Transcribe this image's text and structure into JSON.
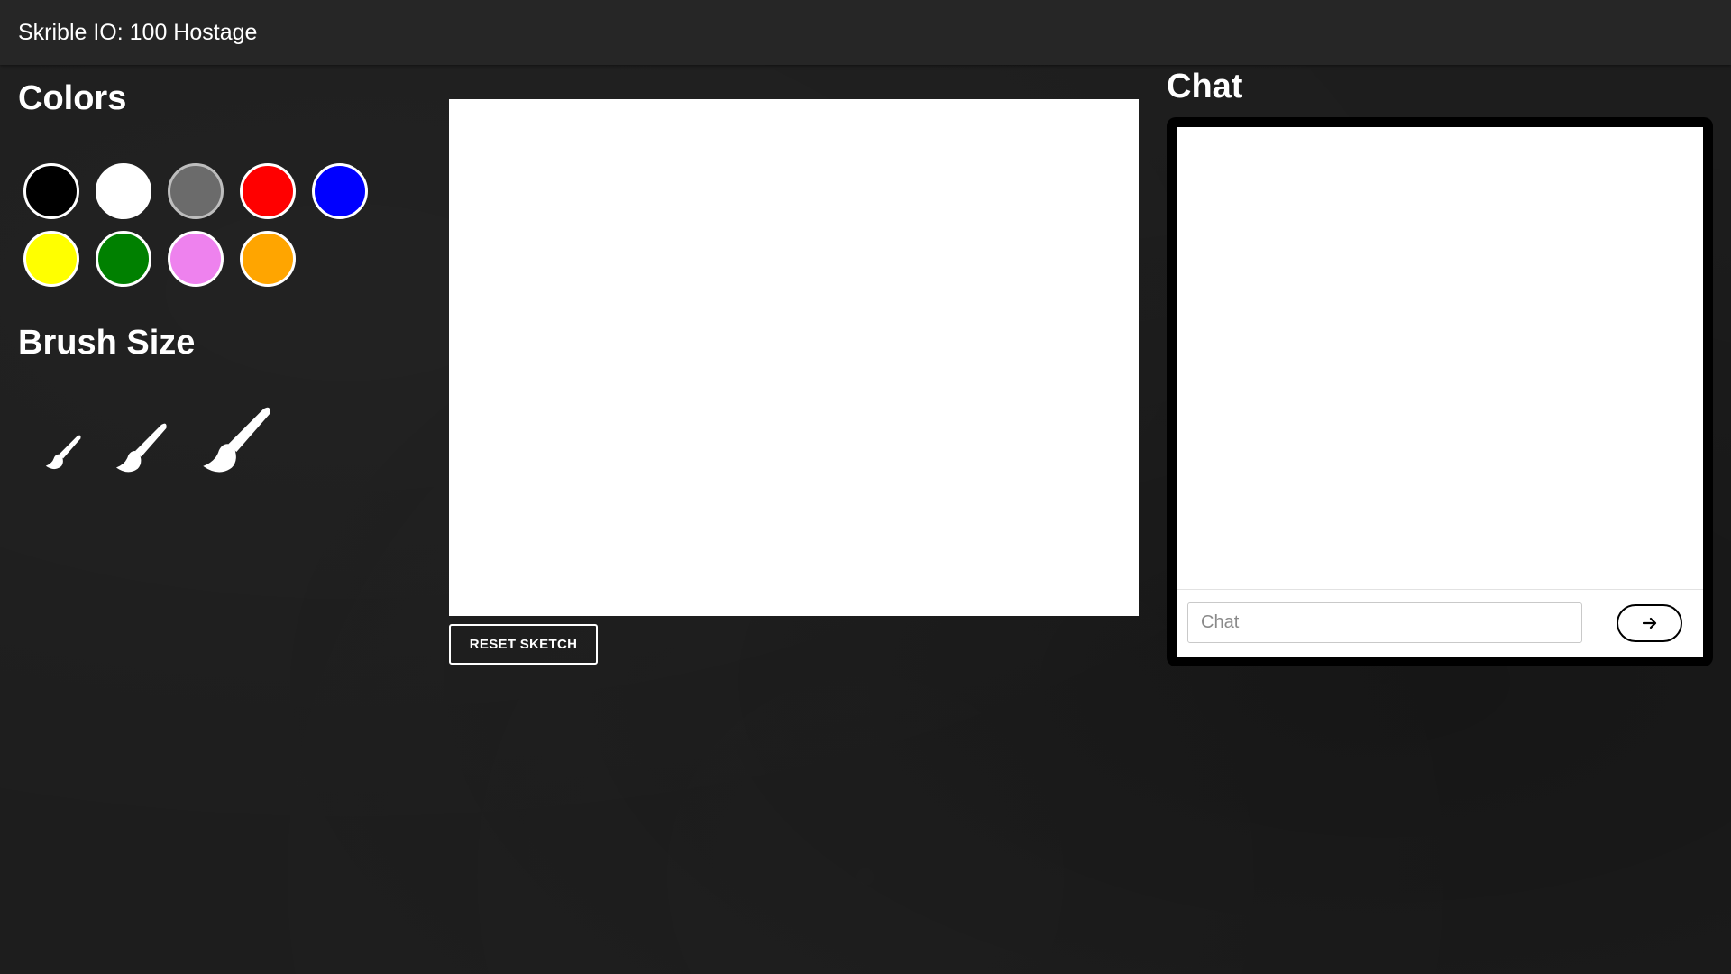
{
  "header": {
    "title": "Skrible IO: 100 Hostage"
  },
  "colors_panel": {
    "heading": "Colors",
    "swatches": [
      {
        "name": "black",
        "color": "#000000"
      },
      {
        "name": "white",
        "color": "#ffffff"
      },
      {
        "name": "gray",
        "color": "#6b6b6b"
      },
      {
        "name": "red",
        "color": "#ff0000"
      },
      {
        "name": "blue",
        "color": "#0000ff"
      },
      {
        "name": "yellow",
        "color": "#ffff00"
      },
      {
        "name": "green",
        "color": "#008000"
      },
      {
        "name": "violet",
        "color": "#ee82ee"
      },
      {
        "name": "orange",
        "color": "#ffa500"
      }
    ]
  },
  "brush_panel": {
    "heading": "Brush Size",
    "brushes": [
      {
        "name": "small-brush-icon"
      },
      {
        "name": "medium-brush-icon"
      },
      {
        "name": "large-brush-icon"
      }
    ]
  },
  "sketch": {
    "reset_label": "RESET SKETCH"
  },
  "chat": {
    "heading": "Chat",
    "input_placeholder": "Chat",
    "input_value": "",
    "send_icon": "arrow-right-icon"
  },
  "theme": {
    "background": "#1d1d1d",
    "topbar": "#262626",
    "canvas": "#ffffff",
    "chat_frame": "#000000"
  }
}
